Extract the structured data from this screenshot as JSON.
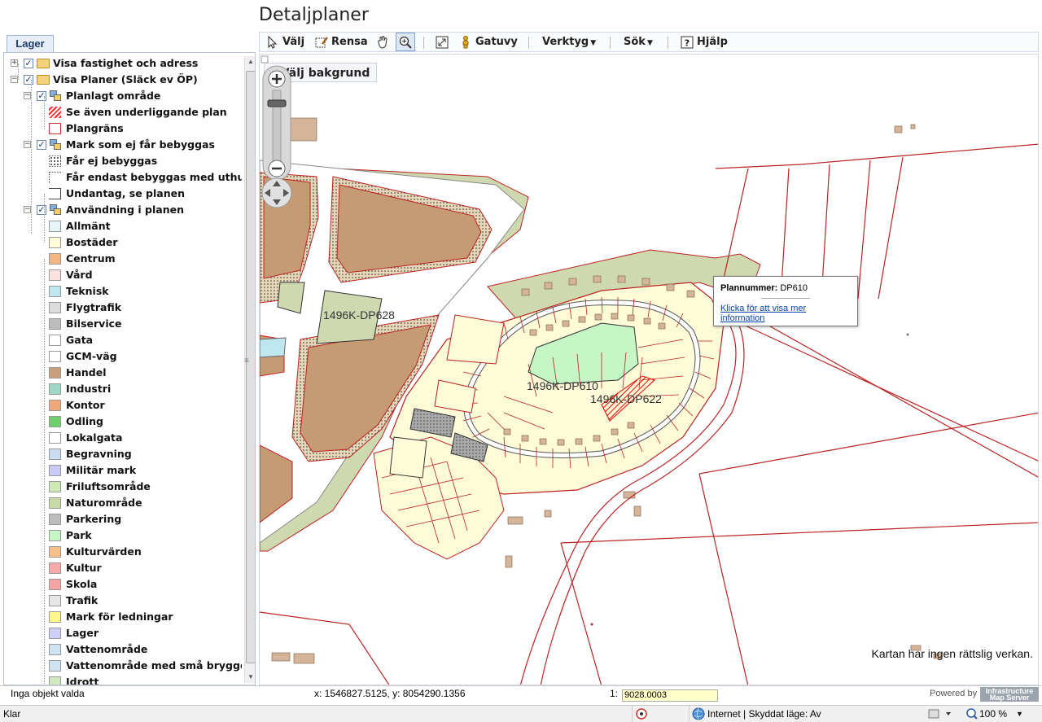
{
  "page": {
    "title": "Detaljplaner"
  },
  "left": {
    "tab": "Lager",
    "tree": [
      {
        "label": "Visa fastighet och adress",
        "level": 0,
        "kind": "folder",
        "checked": true,
        "expander": "+"
      },
      {
        "label": "Visa Planer (Släck ev ÖP)",
        "level": 0,
        "kind": "folder",
        "checked": true,
        "expander": "−"
      },
      {
        "label": "Planlagt område",
        "level": 1,
        "kind": "group",
        "checked": true,
        "expander": "−"
      },
      {
        "label": "Se även underliggande plan",
        "level": 2,
        "kind": "swatch",
        "color": "#ff2d2d",
        "style": "hatch"
      },
      {
        "label": "Plangräns",
        "level": 2,
        "kind": "swatch",
        "color": "#ffffff",
        "style": "red-border"
      },
      {
        "label": "Mark som ej får bebyggas",
        "level": 1,
        "kind": "group",
        "checked": true,
        "expander": "−"
      },
      {
        "label": "Får ej bebyggas",
        "level": 2,
        "kind": "swatch",
        "color": "#ffffff",
        "style": "dots"
      },
      {
        "label": "Får endast bebyggas med uthus",
        "level": 2,
        "kind": "swatch",
        "color": "#ffffff",
        "style": "corner"
      },
      {
        "label": "Undantag, se planen",
        "level": 2,
        "kind": "swatch",
        "color": "#ffffff",
        "style": "bracket"
      },
      {
        "label": "Användning i planen",
        "level": 1,
        "kind": "group",
        "checked": true,
        "expander": "−"
      },
      {
        "label": "Allmänt",
        "level": 2,
        "kind": "swatch",
        "color": "#e6f6f8"
      },
      {
        "label": "Bostäder",
        "level": 2,
        "kind": "swatch",
        "color": "#fdfbd8"
      },
      {
        "label": "Centrum",
        "level": 2,
        "kind": "swatch",
        "color": "#f5b581"
      },
      {
        "label": "Vård",
        "level": 2,
        "kind": "swatch",
        "color": "#fde0e0"
      },
      {
        "label": "Teknisk",
        "level": 2,
        "kind": "swatch",
        "color": "#bfe7ef"
      },
      {
        "label": "Flygtrafik",
        "level": 2,
        "kind": "swatch",
        "color": "#dcdcdc"
      },
      {
        "label": "Bilservice",
        "level": 2,
        "kind": "swatch",
        "color": "#bdbdbd"
      },
      {
        "label": "Gata",
        "level": 2,
        "kind": "swatch",
        "color": "#ffffff"
      },
      {
        "label": "GCM-väg",
        "level": 2,
        "kind": "swatch",
        "color": "#ffffff"
      },
      {
        "label": "Handel",
        "level": 2,
        "kind": "swatch",
        "color": "#c9a07a"
      },
      {
        "label": "Industri",
        "level": 2,
        "kind": "swatch",
        "color": "#9ed8c7"
      },
      {
        "label": "Kontor",
        "level": 2,
        "kind": "swatch",
        "color": "#f0a878"
      },
      {
        "label": "Odling",
        "level": 2,
        "kind": "swatch",
        "color": "#6ccf6c"
      },
      {
        "label": "Lokalgata",
        "level": 2,
        "kind": "swatch",
        "color": "#ffffff"
      },
      {
        "label": "Begravning",
        "level": 2,
        "kind": "swatch",
        "color": "#c9dcf1"
      },
      {
        "label": "Militär mark",
        "level": 2,
        "kind": "swatch",
        "color": "#c9c9f5"
      },
      {
        "label": "Friluftsområde",
        "level": 2,
        "kind": "swatch",
        "color": "#cfe9b4"
      },
      {
        "label": "Naturområde",
        "level": 2,
        "kind": "swatch",
        "color": "#c7d9a4"
      },
      {
        "label": "Parkering",
        "level": 2,
        "kind": "swatch",
        "color": "#bdbdbd"
      },
      {
        "label": "Park",
        "level": 2,
        "kind": "swatch",
        "color": "#c6f5c6"
      },
      {
        "label": "Kulturvärden",
        "level": 2,
        "kind": "swatch",
        "color": "#f8c089"
      },
      {
        "label": "Kultur",
        "level": 2,
        "kind": "swatch",
        "color": "#f7a9a9"
      },
      {
        "label": "Skola",
        "level": 2,
        "kind": "swatch",
        "color": "#f6a3a3"
      },
      {
        "label": "Trafik",
        "level": 2,
        "kind": "swatch",
        "color": "#e6e6e6"
      },
      {
        "label": "Mark för ledningar",
        "level": 2,
        "kind": "swatch",
        "color": "#fdf68a"
      },
      {
        "label": "Lager",
        "level": 2,
        "kind": "swatch",
        "color": "#cfcff7"
      },
      {
        "label": "Vattenområde",
        "level": 2,
        "kind": "swatch",
        "color": "#cfe4f3"
      },
      {
        "label": "Vattenområde med små bryggor",
        "level": 2,
        "kind": "swatch",
        "color": "#cfe4f3"
      },
      {
        "label": "Idrott",
        "level": 2,
        "kind": "swatch",
        "color": "#cfe9c0"
      }
    ]
  },
  "toolbar": {
    "select": "Välj",
    "clear": "Rensa",
    "streetview": "Gatuvy",
    "tools": "Verktyg",
    "search": "Sök",
    "help": "Hjälp"
  },
  "map": {
    "background_button": "Välj bakgrund",
    "labels": {
      "plan_a": "1496K-DP628",
      "plan_b": "1496K-DP610",
      "plan_c": "1496K-DP622"
    },
    "popup": {
      "key": "Plannummer:",
      "value": "DP610",
      "link": "Klicka för att visa mer information"
    },
    "disclaimer": "Kartan har ingen rättslig verkan."
  },
  "status": {
    "selection": "Inga objekt valda",
    "coords": "x: 1546827.5125, y: 8054290.1356",
    "scale_prefix": "1:",
    "scale_value": "9028.0003",
    "powered_by": "Powered by",
    "logo": "Infrastructure Map Server"
  },
  "browser": {
    "status": "Klar",
    "zone": "Internet | Skyddat läge: Av",
    "zoom": "100 %"
  }
}
